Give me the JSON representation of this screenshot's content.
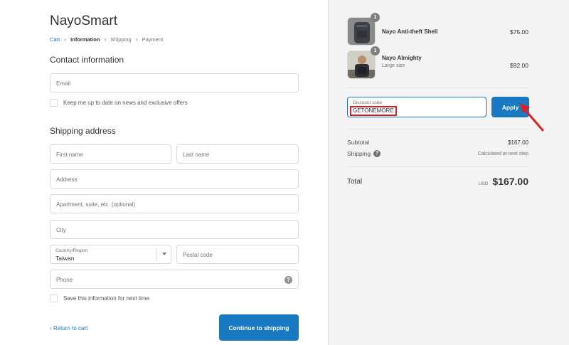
{
  "shop": {
    "name": "NayoSmart"
  },
  "breadcrumb": {
    "cart": "Cart",
    "information": "Information",
    "shipping": "Shipping",
    "payment": "Payment"
  },
  "contact": {
    "title": "Contact information",
    "email_placeholder": "Email",
    "newsletter_label": "Keep me up to date on news and exclusive offers"
  },
  "shipping": {
    "title": "Shipping address",
    "first_name_placeholder": "First name",
    "last_name_placeholder": "Last name",
    "address_placeholder": "Address",
    "apartment_placeholder": "Apartment, suite, etc. (optional)",
    "city_placeholder": "City",
    "country_label": "Country/Region",
    "country_value": "Taiwan",
    "postal_placeholder": "Postal code",
    "phone_placeholder": "Phone",
    "save_info_label": "Save this information for next time"
  },
  "footer": {
    "return_label": "Return to cart",
    "continue_label": "Continue to shipping"
  },
  "order": {
    "products": [
      {
        "name": "Nayo Anti-theft Shell",
        "variant": "",
        "price": "$75.00",
        "qty": "1"
      },
      {
        "name": "Nayo Almighty",
        "variant": "Large size",
        "price": "$92.00",
        "qty": "1"
      }
    ],
    "discount": {
      "label": "Discount code",
      "value": "GETONEMORE",
      "apply_label": "Apply"
    },
    "subtotal_label": "Subtotal",
    "subtotal_value": "$167.00",
    "shipping_label": "Shipping",
    "shipping_value": "Calculated at next step",
    "total_label": "Total",
    "currency": "USD",
    "total_value": "$167.00"
  },
  "colors": {
    "accent": "#1979c3",
    "highlight": "#e02020"
  },
  "icons": {
    "breadcrumb_sep": "chevron-right-icon",
    "back": "chevron-left-icon",
    "help": "question-icon",
    "select": "chevron-down-icon"
  }
}
